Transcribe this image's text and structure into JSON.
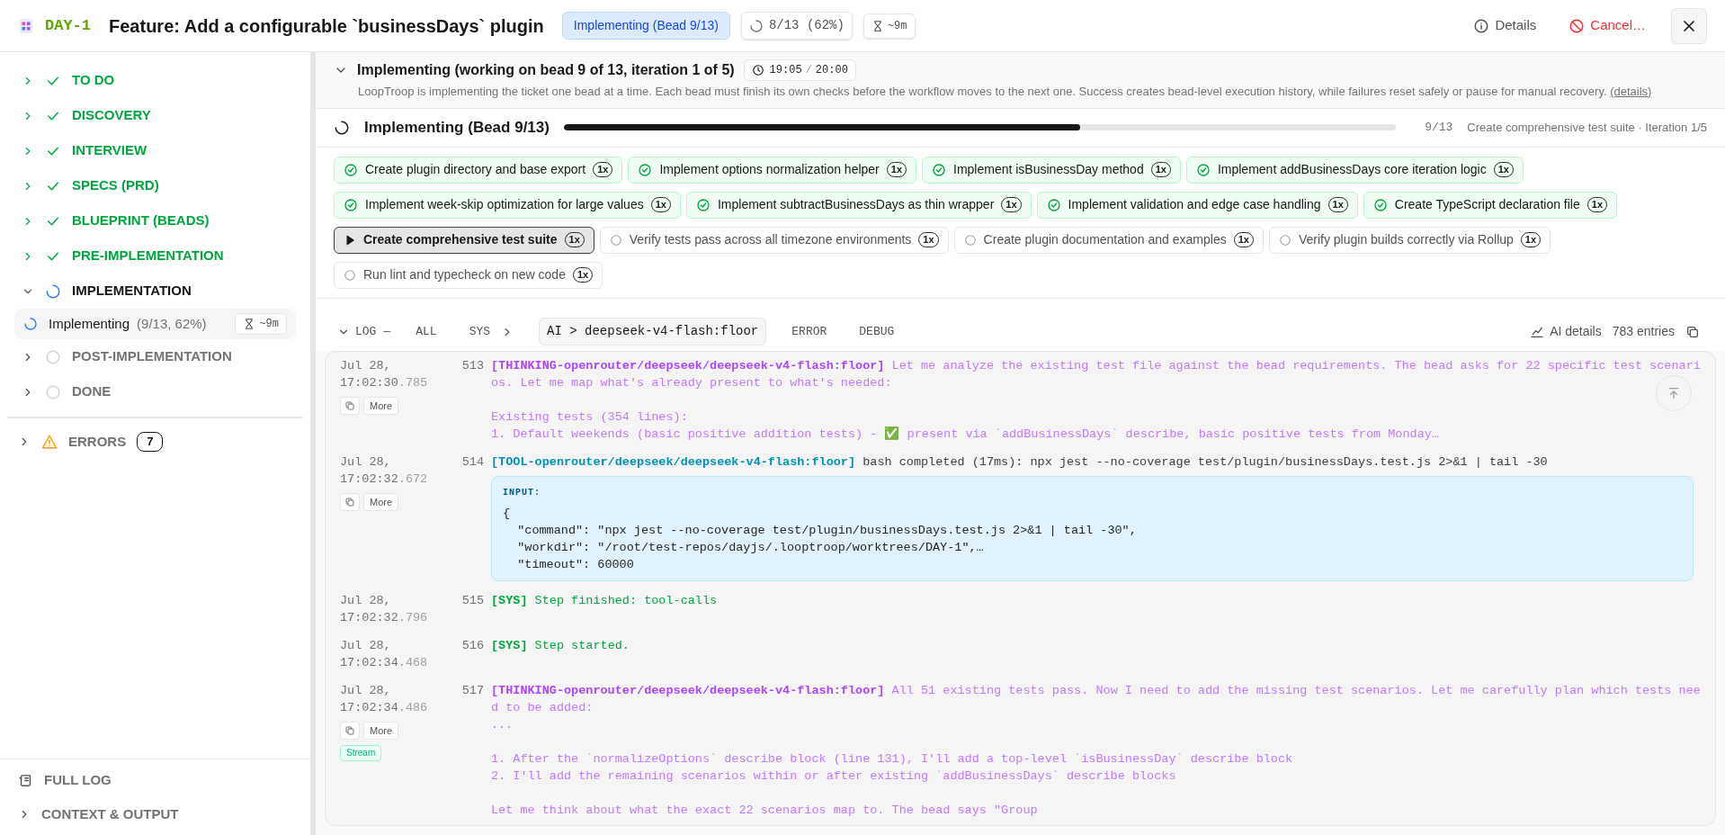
{
  "header": {
    "ticket": "DAY-1",
    "title": "Feature: Add a configurable `businessDays` plugin",
    "status_badge": "Implementing (Bead 9/13)",
    "progress": "8/13 (62%)",
    "eta": "~9m",
    "details": "Details",
    "cancel": "Cancel…"
  },
  "sidebar": {
    "items": [
      {
        "label": "TO DO",
        "kind": "done",
        "expanded": false
      },
      {
        "label": "DISCOVERY",
        "kind": "done",
        "expanded": false
      },
      {
        "label": "INTERVIEW",
        "kind": "done",
        "expanded": false
      },
      {
        "label": "SPECS (PRD)",
        "kind": "done",
        "expanded": false
      },
      {
        "label": "BLUEPRINT (BEADS)",
        "kind": "done",
        "expanded": false
      },
      {
        "label": "PRE-IMPLEMENTATION",
        "kind": "done",
        "expanded": false
      },
      {
        "label": "IMPLEMENTATION",
        "kind": "active",
        "expanded": true,
        "children": [
          {
            "label": "Implementing",
            "detail": "(9/13, 62%)",
            "eta": "~9m",
            "kind": "active",
            "selected": true
          }
        ]
      },
      {
        "label": "POST-IMPLEMENTATION",
        "kind": "pending",
        "expanded": false
      },
      {
        "label": "DONE",
        "kind": "pending",
        "expanded": false
      }
    ],
    "errors": {
      "label": "ERRORS",
      "count": "7",
      "expanded": false
    },
    "footer": [
      {
        "label": "FULL LOG",
        "kind": "log"
      },
      {
        "label": "CONTEXT & OUTPUT",
        "kind": "expand"
      }
    ]
  },
  "stage": {
    "title": "Implementing (working on bead 9 of 13, iteration 1 of 5)",
    "expanded": true,
    "elapsed": "19:05",
    "timer_separator": "/",
    "limit": "20:00",
    "description": "LoopTroop is implementing the ticket one bead at a time. Each bead must finish its own checks before the workflow moves to the next one. Success creates bead-level execution history, while failures reset safely or pause for manual recovery.",
    "details_link": "(details)"
  },
  "progress": {
    "title": "Implementing (Bead 9/13)",
    "level": 0.62,
    "count": "9/13",
    "caption": "Create comprehensive test suite · Iteration 1/5"
  },
  "beads": [
    {
      "label": "Create plugin directory and base export",
      "runs": "1x",
      "kind": "done"
    },
    {
      "label": "Implement options normalization helper",
      "runs": "1x",
      "kind": "done"
    },
    {
      "label": "Implement isBusinessDay method",
      "runs": "1x",
      "kind": "done"
    },
    {
      "label": "Implement addBusinessDays core iteration logic",
      "runs": "1x",
      "kind": "done"
    },
    {
      "label": "Implement week-skip optimization for large values",
      "runs": "1x",
      "kind": "done"
    },
    {
      "label": "Implement subtractBusinessDays as thin wrapper",
      "runs": "1x",
      "kind": "done"
    },
    {
      "label": "Implement validation and edge case handling",
      "runs": "1x",
      "kind": "done"
    },
    {
      "label": "Create TypeScript declaration file",
      "runs": "1x",
      "kind": "done"
    },
    {
      "label": "Create comprehensive test suite",
      "runs": "1x",
      "kind": "active"
    },
    {
      "label": "Verify tests pass across all timezone environments",
      "runs": "1x",
      "kind": "pending"
    },
    {
      "label": "Create plugin documentation and examples",
      "runs": "1x",
      "kind": "pending"
    },
    {
      "label": "Verify plugin builds correctly via Rollup",
      "runs": "1x",
      "kind": "pending"
    },
    {
      "label": "Run lint and typecheck on new code",
      "runs": "1x",
      "kind": "pending"
    }
  ],
  "log": {
    "title": "LOG",
    "expanded": true,
    "separator": "—",
    "tabs": [
      {
        "label": "ALL",
        "selected": false,
        "expandable": false
      },
      {
        "label": "SYS",
        "selected": false,
        "expandable": true
      },
      {
        "label": "AI > deepseek-v4-flash:floor",
        "selected": true,
        "expandable": false
      },
      {
        "label": "ERROR",
        "selected": false,
        "expandable": false
      },
      {
        "label": "DEBUG",
        "selected": false,
        "expandable": false
      }
    ],
    "ai_details": "AI details",
    "entries_count": "783 entries",
    "entries": [
      {
        "date": "Jul 28,",
        "time": "17:02:30",
        "millis": ".785",
        "number": "513",
        "kind": "thinking",
        "tag": "[THINKING-openrouter/deepseek/deepseek-v4-flash:floor]",
        "text": "Let me analyze the existing test file against the bead requirements. The bead asks for 22 specific test scenarios. Let me map what's already present to what's needed:",
        "lines": [
          {
            "text": "Existing tests (354 lines):",
            "spaced": true
          },
          {
            "text": "1. Default weekends (basic positive addition tests) - ✅ present via `addBusinessDays` describe, basic positive tests from Monday…",
            "spaced": false
          }
        ],
        "actions": [
          "More"
        ]
      },
      {
        "date": "Jul 28,",
        "time": "17:02:32",
        "millis": ".672",
        "number": "514",
        "kind": "tool",
        "tag": "[TOOL-openrouter/deepseek/deepseek-v4-flash:floor]",
        "text": "bash completed (17ms): npx jest --no-coverage test/plugin/businessDays.test.js 2>&1 | tail -30",
        "input": {
          "label": "INPUT:",
          "lines": [
            "{",
            "  \"command\": \"npx jest --no-coverage test/plugin/businessDays.test.js 2>&1 | tail -30\",",
            "  \"workdir\": \"/root/test-repos/dayjs/.looptroop/worktrees/DAY-1\",…",
            "  \"timeout\": 60000"
          ]
        },
        "actions": [
          "More"
        ]
      },
      {
        "date": "Jul 28,",
        "time": "17:02:32",
        "millis": ".796",
        "number": "515",
        "kind": "sys",
        "tag": "[SYS]",
        "text": "Step finished: tool-calls"
      },
      {
        "date": "Jul 28,",
        "time": "17:02:34",
        "millis": ".468",
        "number": "516",
        "kind": "sys",
        "tag": "[SYS]",
        "text": "Step started."
      },
      {
        "date": "Jul 28,",
        "time": "17:02:34",
        "millis": ".486",
        "number": "517",
        "kind": "thinking",
        "tag": "[THINKING-openrouter/deepseek/deepseek-v4-flash:floor]",
        "text": "All 51 existing tests pass. Now I need to add the missing test scenarios. Let me carefully plan which tests need to be added:",
        "lines": [
          {
            "text": "...",
            "spaced": false
          },
          {
            "text": "1. After the `normalizeOptions` describe block (line 131), I'll add a top-level `isBusinessDay` describe block",
            "spaced": true
          },
          {
            "text": "2. I'll add the remaining scenarios within or after existing `addBusinessDays` describe blocks",
            "spaced": false
          },
          {
            "text": "Let me think about what the exact 22 scenarios map to. The bead says \"Group",
            "spaced": true
          }
        ],
        "actions": [
          "More"
        ],
        "badge": "Stream"
      }
    ]
  }
}
